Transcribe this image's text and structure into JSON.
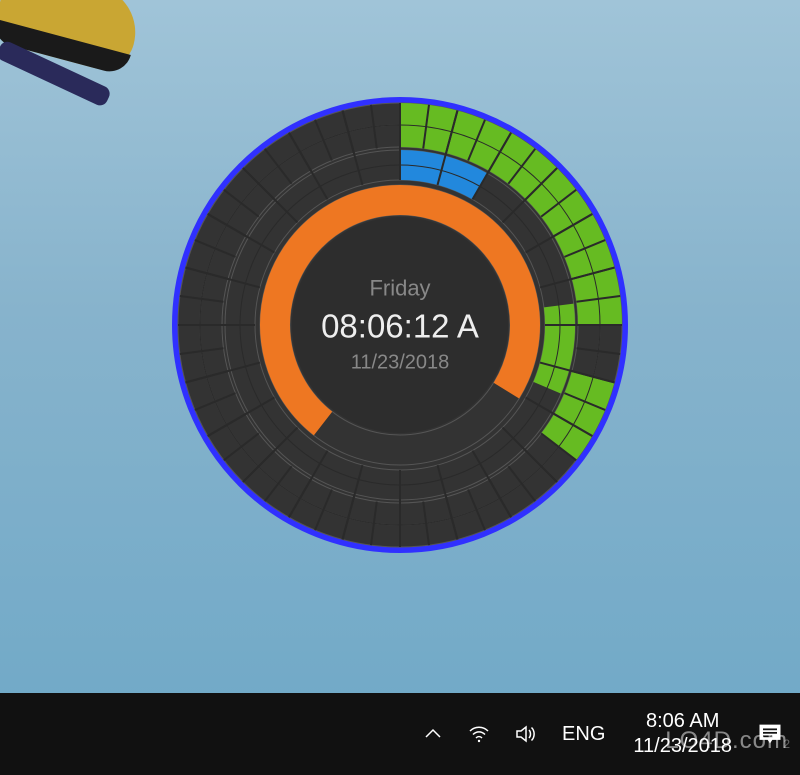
{
  "widget": {
    "day": "Friday",
    "time": "08:06:12 A",
    "date": "11/23/2018",
    "colors": {
      "ring_border": "#3030ff",
      "ring_bg": "#333333",
      "grid": "#555555",
      "center_bg": "#2d2d2d",
      "seconds_arc": "#ee7722",
      "middle_green": "#66bb22",
      "middle_blue": "#2288dd",
      "outer_green": "#66bb22"
    }
  },
  "taskbar": {
    "language": "ENG",
    "time": "8:06 AM",
    "date": "11/23/2018",
    "action_center_count": "2"
  },
  "watermark": "LO4D.com"
}
